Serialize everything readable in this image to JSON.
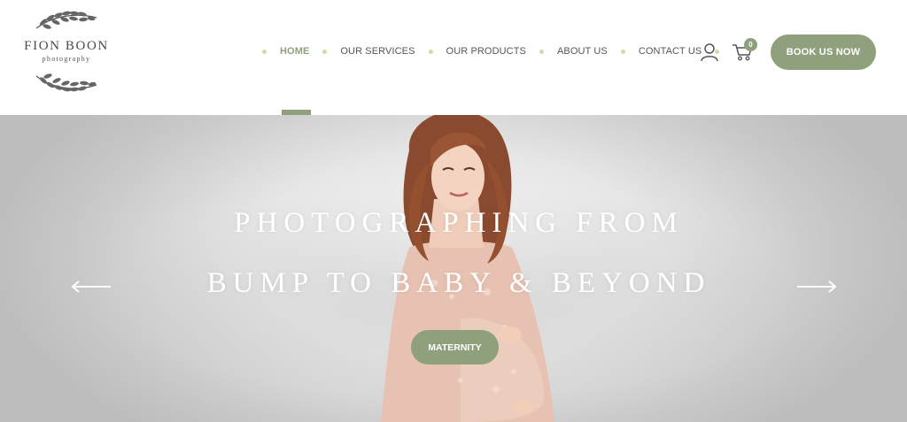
{
  "brand": {
    "name": "FION BOON",
    "tagline": "photography"
  },
  "nav": {
    "items": [
      {
        "label": "HOME",
        "active": true
      },
      {
        "label": "OUR SERVICES",
        "active": false
      },
      {
        "label": "OUR PRODUCTS",
        "active": false
      },
      {
        "label": "ABOUT US",
        "active": false
      },
      {
        "label": "CONTACT US",
        "active": false
      }
    ]
  },
  "header": {
    "user_icon": "user-icon",
    "cart_icon": "cart-icon",
    "cart_count": "0",
    "book_button": "BOOK US NOW"
  },
  "hero": {
    "line1": "PHOTOGRAPHING FROM",
    "line2": "BUMP TO BABY & BEYOND",
    "cta": "MATERNITY",
    "prev_icon": "arrow-left-icon",
    "next_icon": "arrow-right-icon"
  },
  "colors": {
    "accent": "#8fa07c",
    "nav_text": "#555555",
    "nav_dot": "#d9d6a8",
    "hero_bg": "#e6e6e6"
  }
}
